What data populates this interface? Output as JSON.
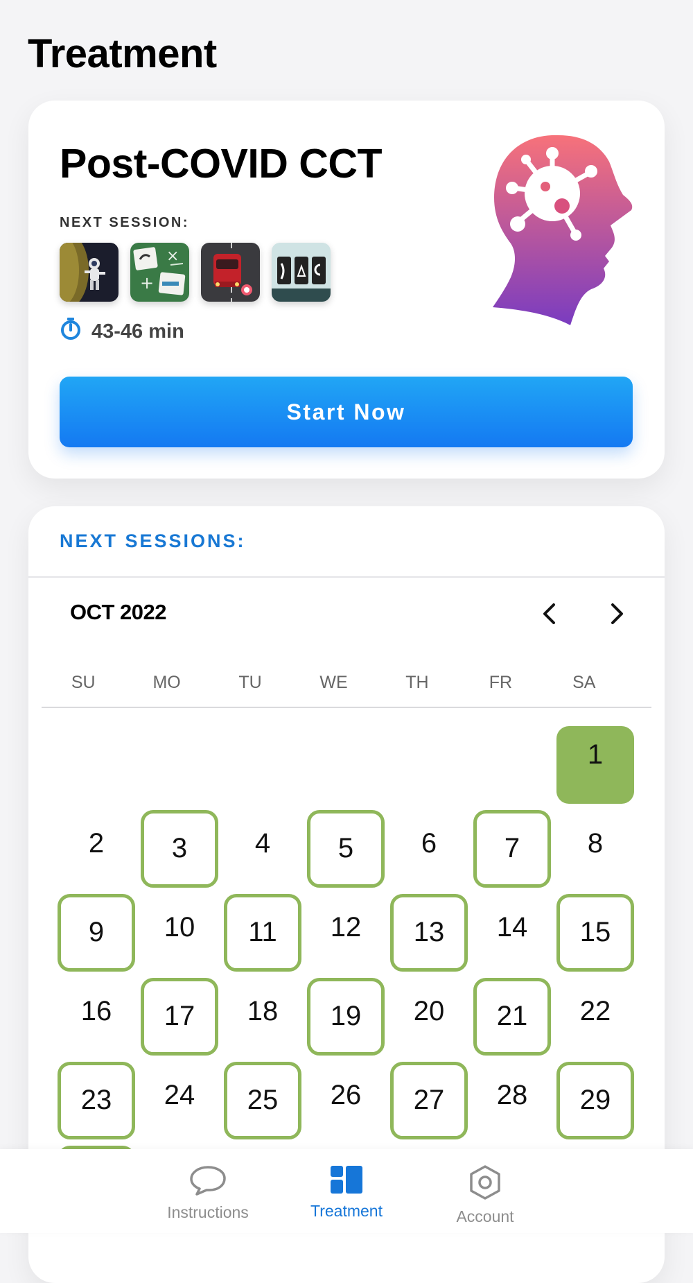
{
  "page": {
    "title": "Treatment"
  },
  "program": {
    "title": "Post-COVID CCT",
    "next_session_label": "NEXT SESSION:",
    "games": [
      {
        "icon": "astronaut-game-icon"
      },
      {
        "icon": "math-cards-game-icon"
      },
      {
        "icon": "car-driving-game-icon"
      },
      {
        "icon": "card-symbols-game-icon"
      }
    ],
    "duration": "43-46 min",
    "start_button": "Start Now",
    "art": "head-virus-icon",
    "colors": {
      "gradient_top": "#f7727a",
      "gradient_bottom": "#7a3cc0"
    }
  },
  "calendar": {
    "section_label": "NEXT SESSIONS:",
    "month": "OCT 2022",
    "weekdays": [
      "SU",
      "MO",
      "TU",
      "WE",
      "TH",
      "FR",
      "SA"
    ],
    "leading_blanks": 6,
    "days": [
      {
        "d": "1",
        "s": "done"
      },
      {
        "d": "2",
        "s": "none"
      },
      {
        "d": "3",
        "s": "sched"
      },
      {
        "d": "4",
        "s": "none"
      },
      {
        "d": "5",
        "s": "sched"
      },
      {
        "d": "6",
        "s": "none"
      },
      {
        "d": "7",
        "s": "sched"
      },
      {
        "d": "8",
        "s": "none"
      },
      {
        "d": "9",
        "s": "sched"
      },
      {
        "d": "10",
        "s": "none"
      },
      {
        "d": "11",
        "s": "sched"
      },
      {
        "d": "12",
        "s": "none"
      },
      {
        "d": "13",
        "s": "sched"
      },
      {
        "d": "14",
        "s": "none"
      },
      {
        "d": "15",
        "s": "sched"
      },
      {
        "d": "16",
        "s": "none"
      },
      {
        "d": "17",
        "s": "sched"
      },
      {
        "d": "18",
        "s": "none"
      },
      {
        "d": "19",
        "s": "sched"
      },
      {
        "d": "20",
        "s": "none"
      },
      {
        "d": "21",
        "s": "sched"
      },
      {
        "d": "22",
        "s": "none"
      },
      {
        "d": "23",
        "s": "sched"
      },
      {
        "d": "24",
        "s": "none"
      },
      {
        "d": "25",
        "s": "sched"
      },
      {
        "d": "26",
        "s": "none"
      },
      {
        "d": "27",
        "s": "sched"
      },
      {
        "d": "28",
        "s": "none"
      },
      {
        "d": "29",
        "s": "sched"
      },
      {
        "d": "",
        "s": "sched"
      }
    ],
    "colors": {
      "session": "#8fb75a"
    }
  },
  "nav": {
    "items": [
      {
        "label": "Instructions",
        "icon": "speech-bubble-icon",
        "active": false
      },
      {
        "label": "Treatment",
        "icon": "grid-icon",
        "active": true
      },
      {
        "label": "Account",
        "icon": "settings-hexagon-icon",
        "active": false
      }
    ],
    "colors": {
      "active": "#1676d8",
      "inactive": "#8d8d8d"
    }
  }
}
